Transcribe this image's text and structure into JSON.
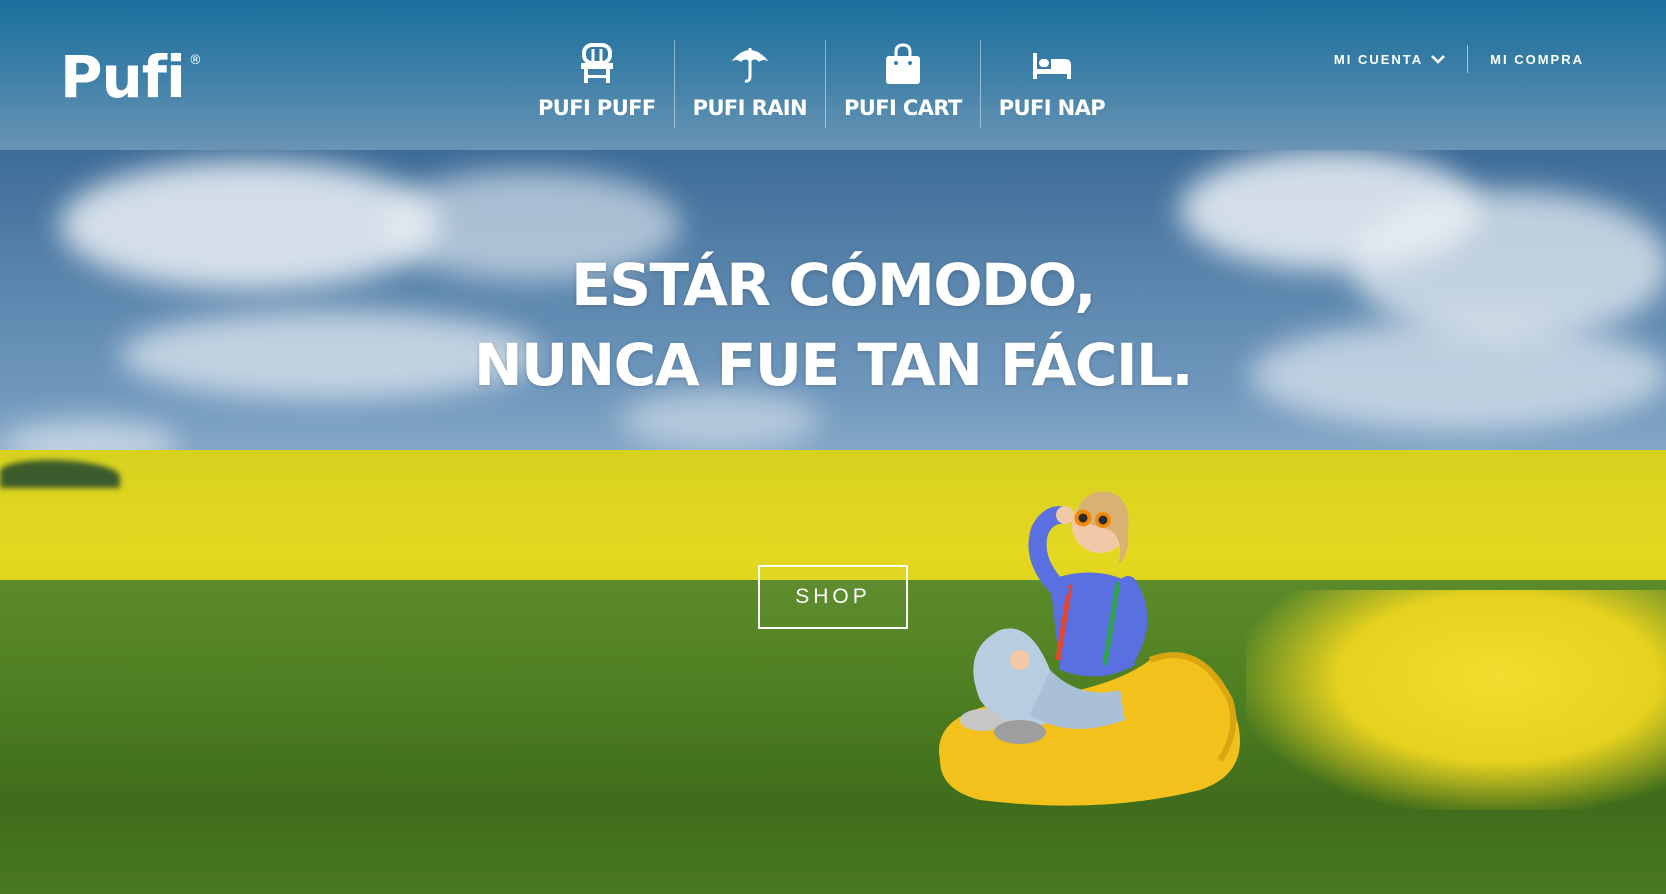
{
  "brand": {
    "name": "Pufi",
    "mark": "®"
  },
  "nav": [
    {
      "label": "PUFI PUFF",
      "icon": "chair-icon"
    },
    {
      "label": "PUFI RAIN",
      "icon": "umbrella-icon"
    },
    {
      "label": "PUFI CART",
      "icon": "shopping-bag-icon"
    },
    {
      "label": "PUFI NAP",
      "icon": "bed-icon"
    }
  ],
  "account": {
    "my_account": "MI CUENTA",
    "my_purchase": "MI COMPRA"
  },
  "hero": {
    "headline_line1": "ESTÁR CÓMODO,",
    "headline_line2": "NUNCA FUE TAN FÁCIL.",
    "cta": "SHOP"
  },
  "colors": {
    "header": "#2f78a3",
    "field_yellow": "#e0d41e",
    "grass_green": "#4e7f22",
    "beanbag_yellow": "#f3c11c"
  }
}
